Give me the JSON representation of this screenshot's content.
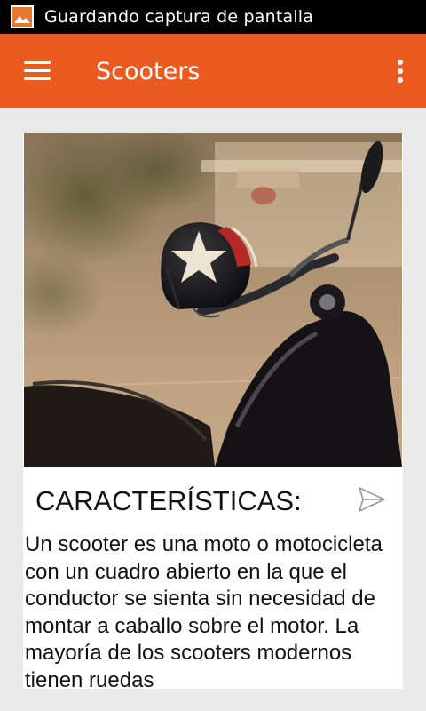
{
  "status_bar": {
    "notification": "Guardando captura de pantalla"
  },
  "app_bar": {
    "title": "Scooters"
  },
  "card": {
    "image_alt": "scooter-with-helmet-photo",
    "title": "CARACTERÍSTICAS:",
    "body": "Un scooter es una moto o motocicleta con un cuadro abierto en la que el conductor se sienta sin necesidad de montar a caballo sobre el motor. La mayoría de los scooters modernos tienen ruedas"
  },
  "colors": {
    "accent": "#eb5a1e",
    "status_bar": "#000000",
    "background": "#e9e9e9"
  }
}
